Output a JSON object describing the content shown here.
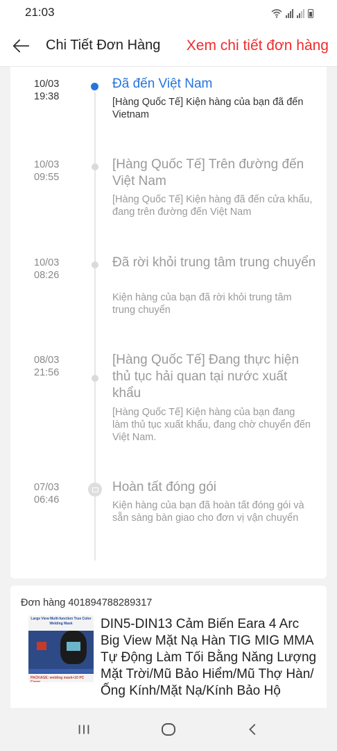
{
  "status_bar": {
    "time": "21:03"
  },
  "header": {
    "title": "Chi Tiết Đơn Hàng",
    "action_link": "Xem chi tiết đơn hàng",
    "accent_color": "#ee2c2c"
  },
  "tracking": {
    "active_color": "#2673dd",
    "events": [
      {
        "date": "10/03",
        "time": "19:38",
        "title": "Đã đến Việt Nam",
        "desc": "[Hàng Quốc Tế] Kiện hàng của bạn đã đến Vietnam",
        "active": true
      },
      {
        "date": "10/03",
        "time": "09:55",
        "title": "[Hàng Quốc Tế] Trên đường đến Việt Nam",
        "desc": "[Hàng Quốc Tế] Kiện hàng đã đến cửa khẩu, đang trên đường đến Việt Nam"
      },
      {
        "date": "10/03",
        "time": "08:26",
        "title": "Đã rời khỏi trung tâm trung chuyển",
        "desc": "Kiện hàng của bạn đã rời khỏi trung tâm trung chuyển"
      },
      {
        "date": "08/03",
        "time": "21:56",
        "title": "[Hàng Quốc Tế] Đang thực hiện thủ tục hải quan tại nước xuất khẩu",
        "desc": "[Hàng Quốc Tế] Kiện hàng của bạn đang làm thủ tục xuất khẩu, đang chờ chuyển đến Việt Nam."
      },
      {
        "date": "07/03",
        "time": "06:46",
        "title": "Hoàn tất đóng gói",
        "desc": "Kiện hàng của bạn đã hoàn tất đóng gói và sẵn sàng bàn giao cho đơn vị vận chuyển"
      }
    ]
  },
  "order": {
    "order_id": "Đơn hàng 401894788289317",
    "product_name": "DIN5-DIN13 Cảm Biến Eara 4 Arc Big View Mặt Nạ Hàn TIG MIG MMA Tự Động Làm Tối Bằng Năng Lượng Mặt Trời/Mũ Bảo Hiểm/Mũ Thợ Hàn/Ống Kính/Mặt Nạ/Kính Bảo Hộ",
    "thumb_text_top": "Large View Multi-function True Color Welding Mask",
    "thumb_text_bottom": "PACKAGE: welding mask+10 PC Cover"
  },
  "nav_icons": [
    "recent-apps-icon",
    "home-icon",
    "back-icon"
  ]
}
